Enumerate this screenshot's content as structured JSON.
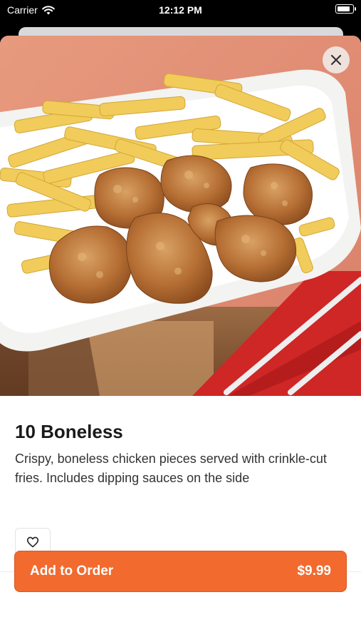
{
  "status_bar": {
    "carrier": "Carrier",
    "time": "12:12 PM",
    "battery_level": 0.9
  },
  "product": {
    "title": "10 Boneless",
    "description": "Crispy, boneless chicken pieces served with crinkle-cut fries. Includes dipping sauces on the side",
    "image_icon": "chicken-and-fries-photo"
  },
  "actions": {
    "close_icon": "close-icon",
    "favorite_icon": "heart-icon",
    "add_label": "Add to Order",
    "price": "$9.99"
  },
  "colors": {
    "accent": "#f26a2e",
    "text": "#1a1a1a",
    "secondary_text": "#333333"
  }
}
